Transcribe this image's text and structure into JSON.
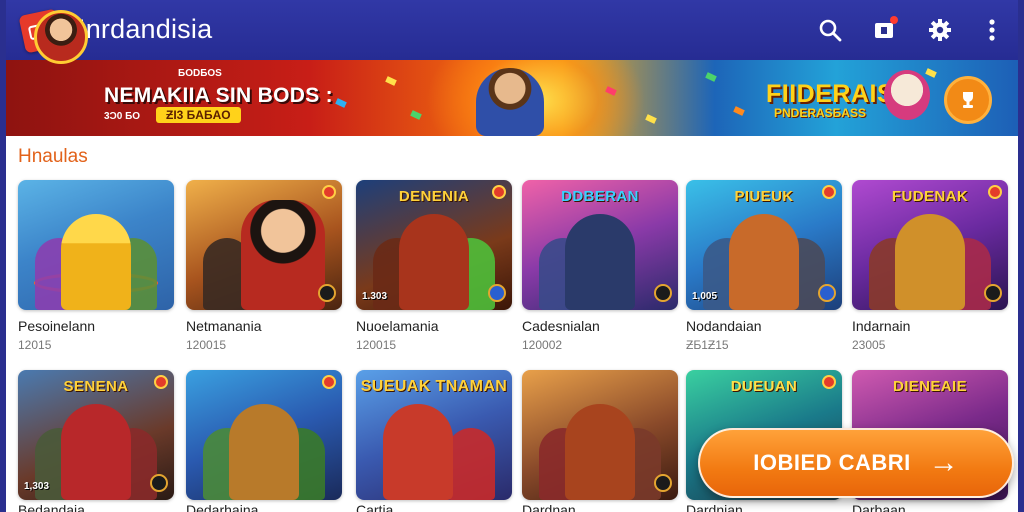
{
  "app": {
    "title": "Inrdandisia",
    "colors": {
      "topbar": "#2a2f8f",
      "accent": "#e2621a",
      "cta": "#f27a12"
    }
  },
  "toolbar": {
    "icons": [
      "search-icon",
      "notifications-icon",
      "settings-icon",
      "more-vert-icon"
    ]
  },
  "banner": {
    "eyebrow": "ƂODƂOS",
    "headline": "NEMAKIIA SIN BODS :",
    "sub": "3Ɔ0 ƂO",
    "badge": "ƵI3 ƂAƂAO",
    "promo_title": "FIIDERAIS",
    "promo_sub": "PNDERASƂASS"
  },
  "section": {
    "title": "Hnaulas"
  },
  "games": [
    {
      "name": "Pesoinelann",
      "meta": "12015",
      "logo": "",
      "count": ""
    },
    {
      "name": "Netmanania",
      "meta": "120015",
      "logo": "",
      "count": ""
    },
    {
      "name": "Nuoelamania",
      "meta": "120015",
      "logo": "DENENIA",
      "count": "1.303"
    },
    {
      "name": "Cadesnialan",
      "meta": "120002",
      "logo": "DDBERAN",
      "count": ""
    },
    {
      "name": "Nodandaian",
      "meta": "ƵƂ1Ƶ15",
      "logo": "PIUEUK",
      "count": "1,005"
    },
    {
      "name": "Indarnain",
      "meta": "23005",
      "logo": "FUDENAK",
      "count": ""
    },
    {
      "name": "Bedandaia",
      "meta": "",
      "logo": "SENENA",
      "count": "1,303"
    },
    {
      "name": "Dedarhaina",
      "meta": "",
      "logo": "",
      "count": ""
    },
    {
      "name": "Cartia",
      "meta": "",
      "logo": "SUEUAK TNAMAN",
      "count": ""
    },
    {
      "name": "Dardnan",
      "meta": "",
      "logo": "",
      "count": ""
    },
    {
      "name": "Dardnian",
      "meta": "",
      "logo": "DUEUAN",
      "count": ""
    },
    {
      "name": "Darbaan",
      "meta": "",
      "logo": "DIENEAIE",
      "count": ""
    }
  ],
  "cta": {
    "label": "IOBIED CABRI",
    "arrow": "→"
  }
}
